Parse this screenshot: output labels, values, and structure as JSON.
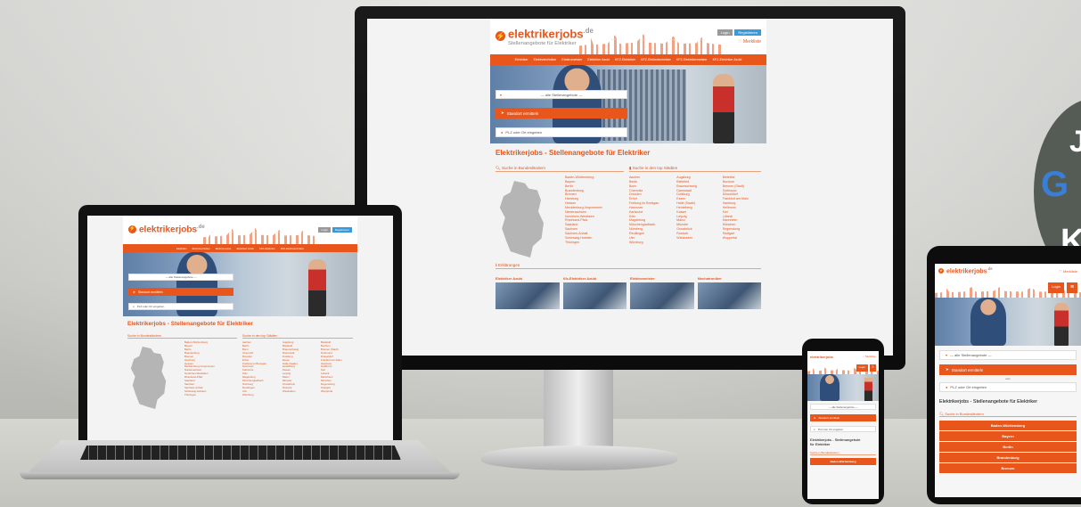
{
  "site": {
    "logo_text": "elektrikerjobs",
    "logo_tld": ".de",
    "tagline": "Stellenangebote für Elektriker",
    "login_label": "Login",
    "register_label": "Registrieren",
    "merkliste_label": "♡ Merkliste",
    "nav": [
      "Elektriker",
      "Elektrotechniker",
      "Elektromeister",
      "Elektriker Azubi",
      "KFZ-Elektriker",
      "KFZ-Elektrotechniker",
      "KFZ-Elektrikermeister",
      "KFZ-Elektriker Azubi"
    ],
    "search_select": "— alle Stellenangebote —",
    "locate_button": "Standort ermitteln",
    "oder": "oder",
    "plz_placeholder": "PLZ oder Ort eingeben",
    "page_title": "Elektrikerjobs - Stellenangebote für Elektriker",
    "mobile_title_1": "Elektrikerjobs - Stellenangebote",
    "mobile_title_2": "für Elektriker",
    "bundeslaender_heading": "Suche in Bundesländern",
    "staedte_heading": "Suche in den top Städten",
    "bundeslaender": [
      "Baden-Württemberg",
      "Bayern",
      "Berlin",
      "Brandenburg",
      "Bremen",
      "Hamburg",
      "Hessen",
      "Mecklenburg-Vorpommern",
      "Niedersachsen",
      "Nordrhein-Westfalen",
      "Rheinland-Pfalz",
      "Saarland",
      "Sachsen",
      "Sachsen-Anhalt",
      "Schleswig-Holstein",
      "Thüringen"
    ],
    "staedte_col1": [
      "Aachen",
      "Berlin",
      "Bonn",
      "Chemnitz",
      "Dresden",
      "Erfurt",
      "Freiburg im Breisgau",
      "Hannover",
      "Karlsruhe",
      "Köln",
      "Magdeburg",
      "Mönchengladbach",
      "Nürnberg",
      "Reutlingen",
      "Ulm",
      "Würzburg"
    ],
    "staedte_col2": [
      "Augsburg",
      "Bielefeld",
      "Braunschweig",
      "Darmstadt",
      "Duisburg",
      "Essen",
      "Halle (Saale)",
      "Heidelberg",
      "Kassel",
      "Leipzig",
      "Mainz",
      "Münster",
      "Osnabrück",
      "Rostock",
      "Wiesbaden"
    ],
    "staedte_col3": [
      "Bielefeld",
      "Bochum",
      "Bremen (Stadt)",
      "Dortmund",
      "Düsseldorf",
      "Frankfurt am Main",
      "Hamburg",
      "Heilbronn",
      "Kiel",
      "Lübeck",
      "Mannheim",
      "München",
      "Regensburg",
      "Stuttgart",
      "Wuppertal"
    ],
    "erklaerungen_heading": "Erklärungen",
    "categories": [
      "Elektriker Azubi",
      "Kfz-Elektriker Azubi",
      "Elektromeister",
      "Mechatroniker"
    ],
    "mobile_states": [
      "Baden-Württemberg",
      "Bayern",
      "Berlin",
      "Brandenburg",
      "Bremen"
    ]
  },
  "badge": {
    "line1": "J",
    "line2": "G",
    "line3": "K"
  },
  "colors": {
    "brand": "#e8561c",
    "device_frame": "#111111",
    "screen_bg": "#f3f3f3"
  }
}
